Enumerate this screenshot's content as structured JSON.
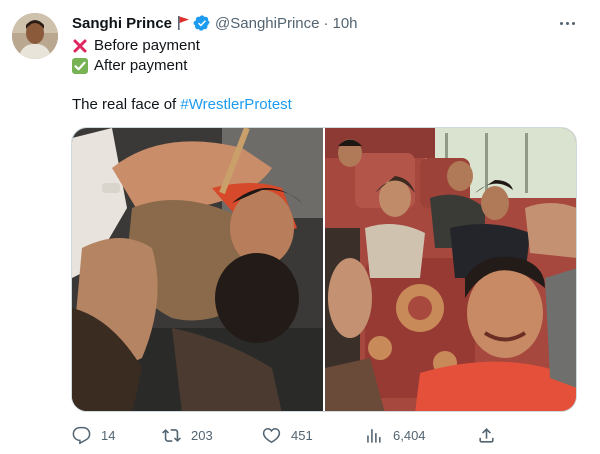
{
  "author": {
    "name": "Sanghi Prince",
    "handle": "@SanghiPrince",
    "separator": "·",
    "time": "10h"
  },
  "tweet": {
    "line1": "Before payment",
    "line2": "After payment",
    "line3_prefix": "The real face of ",
    "hashtag": "#WrestlerProtest"
  },
  "stats": {
    "replies": "14",
    "retweets": "203",
    "likes": "451",
    "views": "6,404"
  },
  "colors": {
    "accent": "#1d9bf0",
    "text": "#0f1419",
    "muted": "#536471",
    "cross": "#e0245e",
    "check": "#77b255",
    "flag": "#e0302c"
  }
}
